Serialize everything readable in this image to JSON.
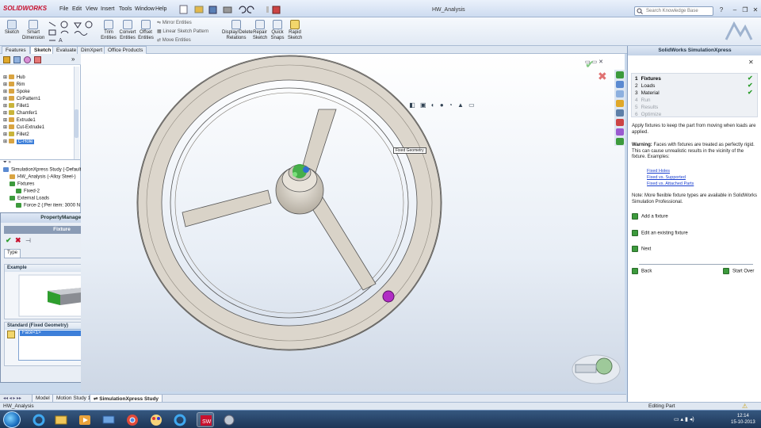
{
  "app": {
    "logo": "SOLIDWORKS",
    "document_title": "HW_Analysis",
    "menu": [
      "File",
      "Edit",
      "View",
      "Insert",
      "Tools",
      "Window",
      "Help"
    ],
    "search_placeholder": "Search Knowledge Base"
  },
  "commands": {
    "big": [
      {
        "label": "Sketch"
      },
      {
        "label": "Smart Dimension"
      },
      {
        "label": "Trim Entities"
      },
      {
        "label": "Convert Entities"
      },
      {
        "label": "Offset Entities"
      },
      {
        "label": "Display/Delete Relations"
      },
      {
        "label": "Repair Sketch"
      },
      {
        "label": "Quick Snaps"
      },
      {
        "label": "Rapid Sketch"
      }
    ],
    "small": [
      "Mirror Entities",
      "Linear Sketch Pattern",
      "Move Entities"
    ]
  },
  "command_tabs": [
    "Features",
    "Sketch",
    "Evaluate",
    "DimXpert",
    "Office Products"
  ],
  "feature_tree": [
    {
      "label": "Hub",
      "color": "#d9a441"
    },
    {
      "label": "Rim",
      "color": "#d9a441"
    },
    {
      "label": "Spoke",
      "color": "#d9a441"
    },
    {
      "label": "CirPattern1",
      "color": "#d9a441"
    },
    {
      "label": "Fillet1",
      "color": "#c9b43a"
    },
    {
      "label": "Chamfer1",
      "color": "#c9b43a"
    },
    {
      "label": "Extrude1",
      "color": "#d9a441"
    },
    {
      "label": "Cut-Extrude1",
      "color": "#d9a441"
    },
    {
      "label": "Fillet2",
      "color": "#c9b43a"
    },
    {
      "label": "C-Hole",
      "color": "#d9a441"
    }
  ],
  "study_tree": [
    {
      "label": "SimulationXpress Study (-Default",
      "indent": 0
    },
    {
      "label": "HW_Analysis (-Alloy Steel-)",
      "indent": 1
    },
    {
      "label": "Fixtures",
      "indent": 1
    },
    {
      "label": "Fixed-2",
      "indent": 2
    },
    {
      "label": "External Loads",
      "indent": 1
    },
    {
      "label": "Force-2 (:Per item: 3000 N",
      "indent": 2
    }
  ],
  "property_manager": {
    "header": "PropertyManager",
    "title": "Fixture",
    "tab": "Type",
    "example_label": "Example",
    "standard_label": "Standard (Fixed Geometry)",
    "selection": "Face<1>"
  },
  "viewport": {
    "fixed_geometry_label": "Fixed Geometry"
  },
  "simxpress": {
    "title": "SolidWorks SimulationXpress",
    "steps": [
      {
        "num": "1",
        "label": "Fixtures",
        "state": "active",
        "check": true
      },
      {
        "num": "2",
        "label": "Loads",
        "state": "done",
        "check": true
      },
      {
        "num": "3",
        "label": "Material",
        "state": "done",
        "check": true
      },
      {
        "num": "4",
        "label": "Run",
        "state": "disabled",
        "check": false
      },
      {
        "num": "5",
        "label": "Results",
        "state": "disabled",
        "check": false
      },
      {
        "num": "6",
        "label": "Optimize",
        "state": "disabled",
        "check": false
      }
    ],
    "intro": "Apply fixtures to keep the part from moving when loads are applied.",
    "warning_bold": "Warning:",
    "warning": " Faces with fixtures are treated as perfectly rigid. This can cause unrealistic results in the vicinity of the fixture. Examples:",
    "links": [
      "Fixed Holes",
      "Fixed vs. Supported",
      "Fixed vs. Attached Parts"
    ],
    "note": "Note: More flexible fixture types are available in SolidWorks Simulation Professional.",
    "actions": [
      "Add a fixture",
      "Edit an existing fixture",
      "Next"
    ],
    "back": "Back",
    "start_over": "Start Over"
  },
  "model_tabs": [
    "Model",
    "Motion Study 1",
    "SimulationXpress Study"
  ],
  "status": {
    "left": "HW_Analysis",
    "mode": "Editing Part"
  },
  "clock": {
    "time": "12:14",
    "date": "15-10-2013"
  }
}
